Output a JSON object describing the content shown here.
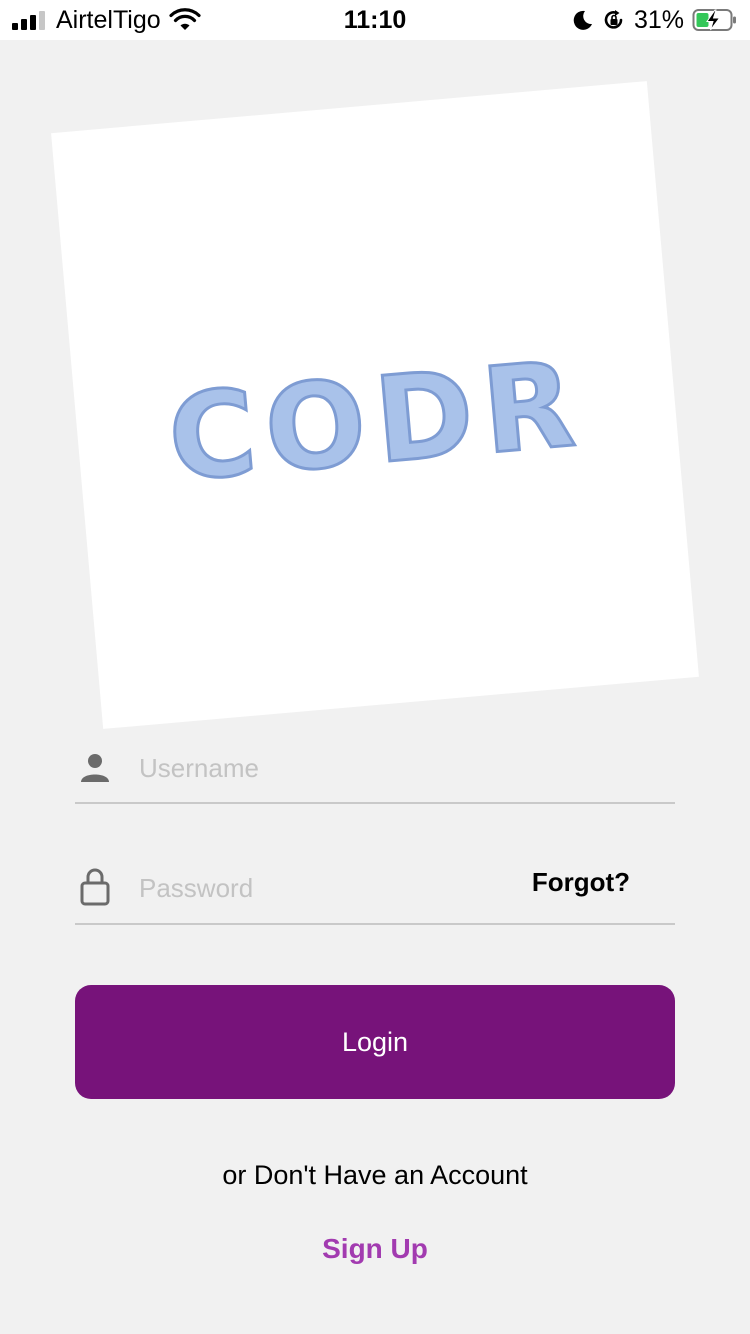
{
  "status_bar": {
    "carrier": "AirtelTigo",
    "time": "11:10",
    "battery_percent": "31%",
    "icons": [
      "signal-icon",
      "wifi-icon",
      "moon-icon",
      "rotation-lock-icon",
      "battery-charging-icon"
    ]
  },
  "logo": {
    "text": "CODR",
    "color": "#a9c2ea"
  },
  "form": {
    "username_placeholder": "Username",
    "password_placeholder": "Password",
    "forgot_label": "Forgot?",
    "login_label": "Login",
    "alt_text": "or Don't Have an Account",
    "signup_label": "Sign Up"
  },
  "colors": {
    "primary": "#77137a",
    "link": "#a23bb0",
    "background": "#f1f1f1"
  }
}
